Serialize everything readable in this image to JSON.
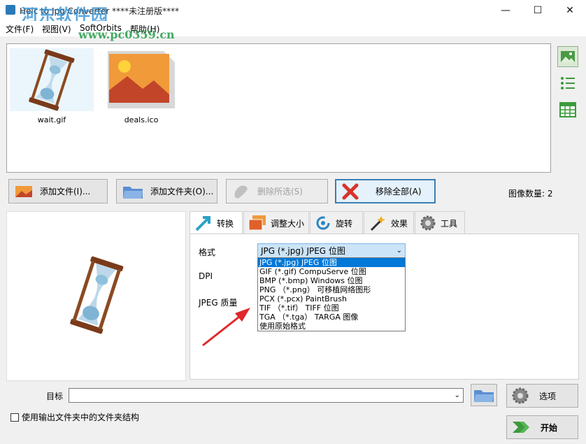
{
  "window": {
    "title": "Heic to Jpg Converter  ****未注册版****",
    "min_glyph": "—",
    "max_glyph": "☐",
    "close_glyph": "✕"
  },
  "watermark": {
    "text": "河东软件园",
    "url": "www.pc0359.cn"
  },
  "menu": [
    "文件(F)",
    "视图(V)",
    "SoftOrbits",
    "帮助(H)"
  ],
  "files": [
    {
      "name": "wait.gif",
      "icon": "hourglass-icon"
    },
    {
      "name": "deals.ico",
      "icon": "image-icon"
    }
  ],
  "toolbar": {
    "add_files": "添加文件(I)...",
    "add_folder": "添加文件夹(O)...",
    "remove_selected": "删除所选(S)",
    "remove_all": "移除全部(A)"
  },
  "image_count": "图像数量: 2",
  "tabs": [
    "转换",
    "调整大小",
    "旋转",
    "效果",
    "工具"
  ],
  "convert": {
    "format_label": "格式",
    "format_value": "JPG (*.jpg) JPEG 位图",
    "dpi_label": "DPI",
    "quality_label": "JPEG 质量",
    "options": [
      "JPG (*.jpg) JPEG 位图",
      "GIF (*.gif) CompuServe 位图",
      "BMP (*.bmp) Windows 位图",
      "PNG （*.png） 可移植网络图形",
      "PCX (*.pcx) PaintBrush",
      "TIF （*.tif） TIFF 位图",
      "TGA （*.tga） TARGA 图像",
      "使用原始格式"
    ]
  },
  "destination": {
    "label": "目标",
    "value": ""
  },
  "options_button": "选项",
  "start_button": "开始",
  "keep_structure": "使用输出文件夹中的文件夹结构",
  "colors": {
    "accent": "#0078d7",
    "arrow": "#e0282a"
  }
}
